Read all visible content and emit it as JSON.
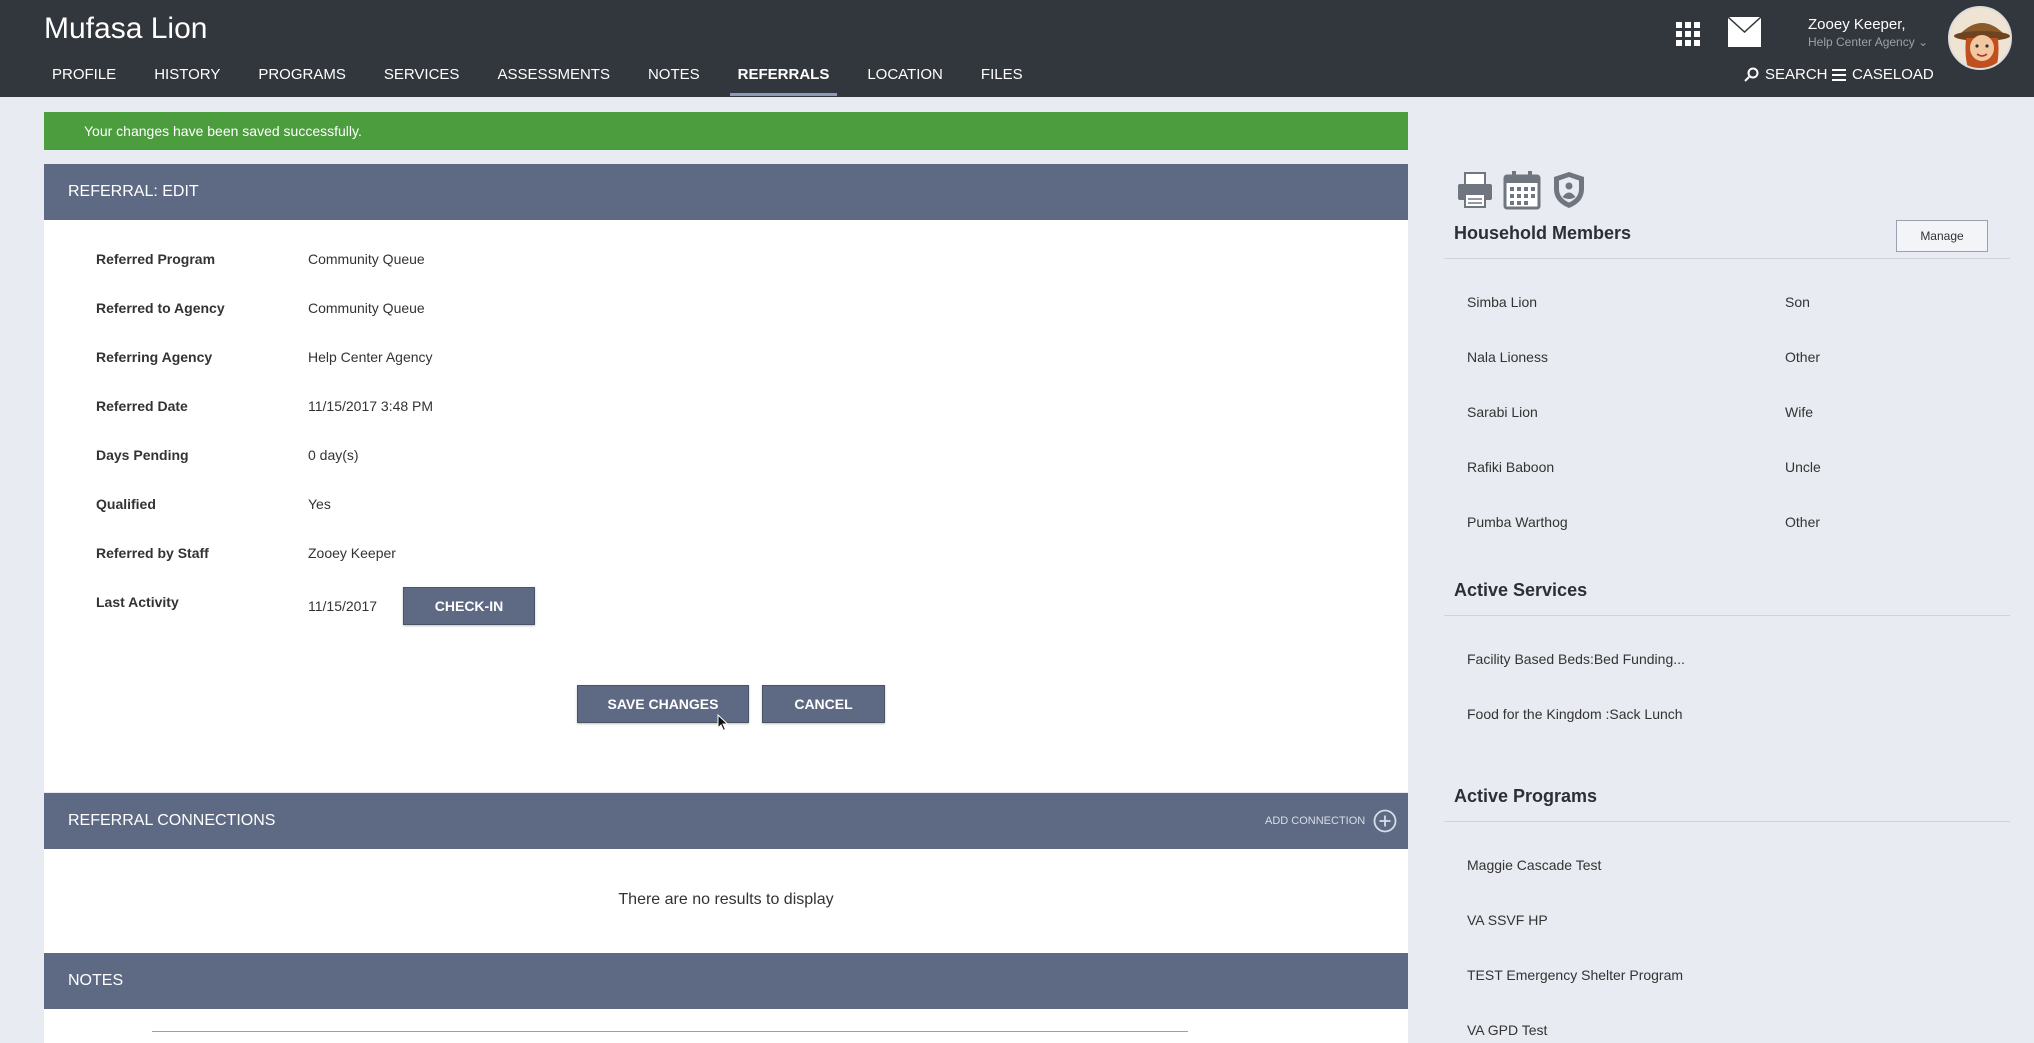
{
  "header": {
    "client_name": "Mufasa Lion",
    "nav": [
      "PROFILE",
      "HISTORY",
      "PROGRAMS",
      "SERVICES",
      "ASSESSMENTS",
      "NOTES",
      "REFERRALS",
      "LOCATION",
      "FILES"
    ],
    "active_nav": "REFERRALS",
    "user_name": "Zooey Keeper,",
    "user_agency": "Help Center Agency",
    "search_label": "SEARCH",
    "caseload_label": "CASELOAD"
  },
  "alert": {
    "message": "Your changes have been saved successfully."
  },
  "referral": {
    "title": "REFERRAL: EDIT",
    "fields": [
      {
        "label": "Referred Program",
        "value": "Community Queue"
      },
      {
        "label": "Referred to Agency",
        "value": "Community Queue"
      },
      {
        "label": "Referring Agency",
        "value": "Help Center Agency"
      },
      {
        "label": "Referred Date",
        "value": "11/15/2017 3:48 PM"
      },
      {
        "label": "Days Pending",
        "value": "0 day(s)"
      },
      {
        "label": "Qualified",
        "value": "Yes"
      },
      {
        "label": "Referred by Staff",
        "value": "Zooey Keeper"
      },
      {
        "label": "Last Activity",
        "value": "11/15/2017"
      }
    ],
    "checkin_label": "CHECK-IN",
    "save_label": "SAVE CHANGES",
    "cancel_label": "CANCEL"
  },
  "connections": {
    "title": "REFERRAL CONNECTIONS",
    "add_label": "ADD CONNECTION",
    "empty_text": "There are no results to display"
  },
  "notes": {
    "title": "NOTES"
  },
  "sidebar": {
    "household_title": "Household Members",
    "manage_label": "Manage",
    "household": [
      {
        "name": "Simba Lion",
        "relation": "Son"
      },
      {
        "name": "Nala Lioness",
        "relation": "Other"
      },
      {
        "name": "Sarabi Lion",
        "relation": "Wife"
      },
      {
        "name": "Rafiki Baboon",
        "relation": "Uncle"
      },
      {
        "name": "Pumba Warthog",
        "relation": "Other"
      }
    ],
    "services_title": "Active Services",
    "services": [
      "Facility Based Beds:Bed Funding...",
      "Food for the Kingdom :Sack Lunch"
    ],
    "programs_title": "Active Programs",
    "programs": [
      "Maggie Cascade Test",
      "VA SSVF HP",
      "TEST Emergency Shelter Program",
      "VA GPD Test"
    ]
  },
  "colors": {
    "header_bg": "#32363d",
    "panel_head": "#5e6a84",
    "success": "#4b9d3d",
    "page_bg": "#e8ebf1"
  },
  "icons": [
    "apps-grid-icon",
    "mail-icon",
    "chevron-down-icon",
    "search-icon",
    "menu-icon",
    "print-icon",
    "calendar-icon",
    "shield-icon",
    "add-circle-icon",
    "mouse-cursor-icon"
  ]
}
